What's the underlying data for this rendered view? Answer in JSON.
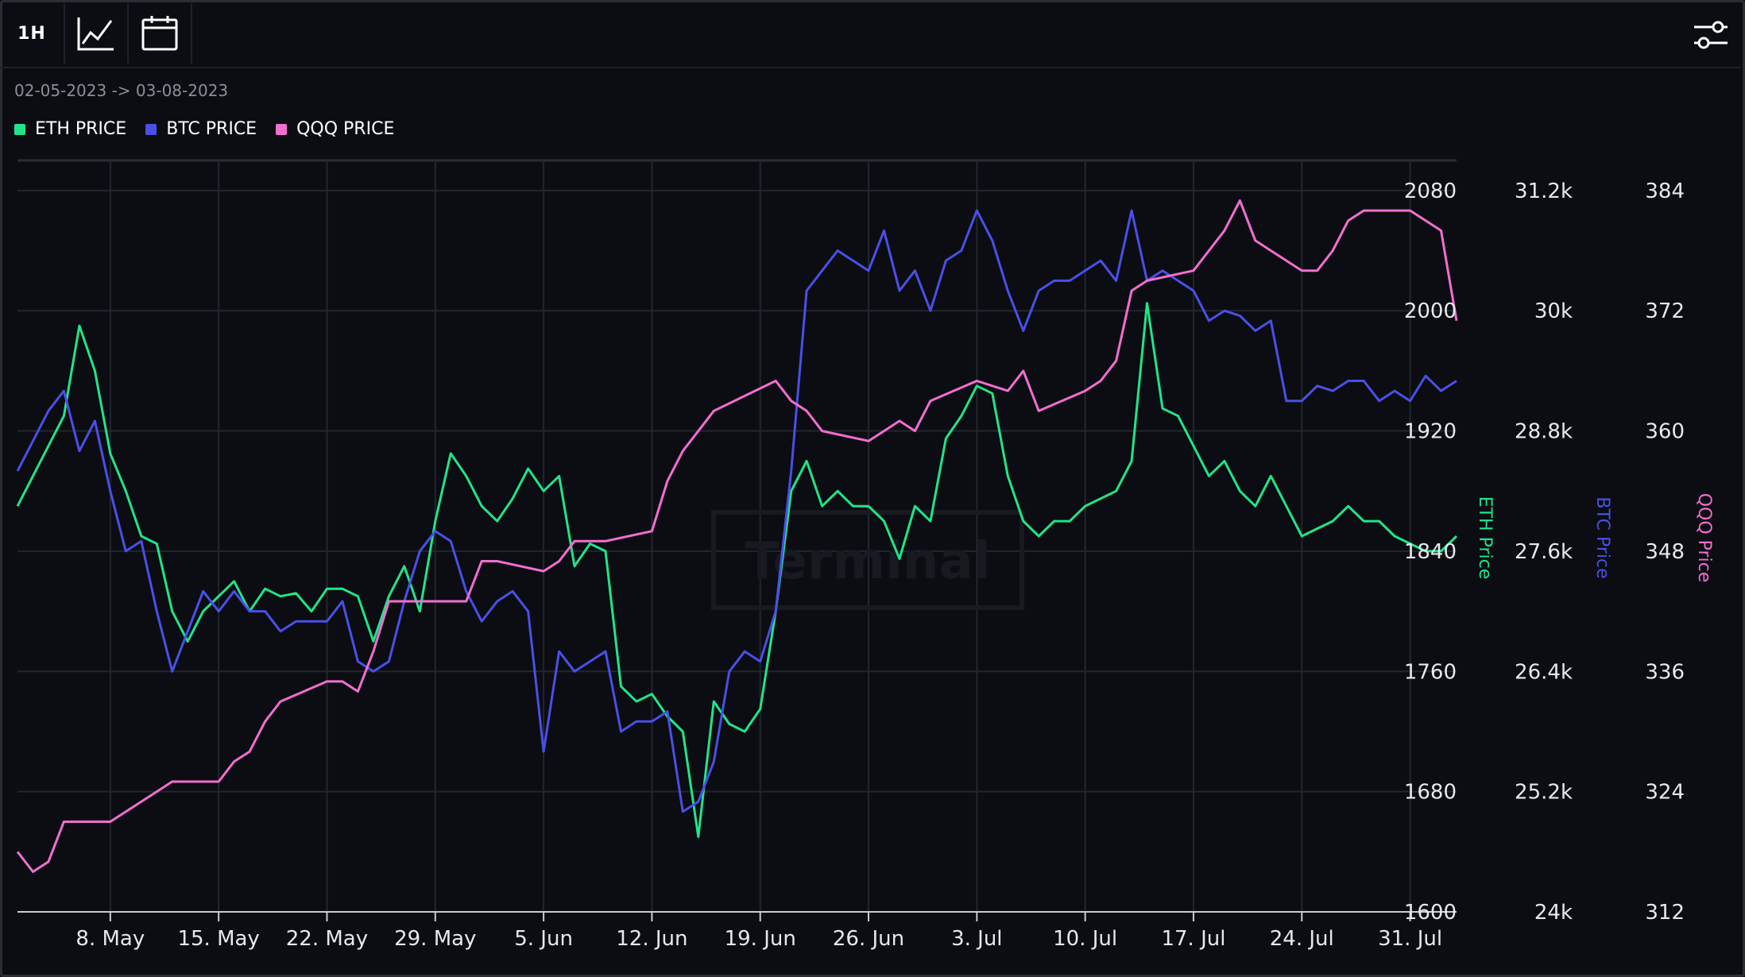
{
  "toolbar": {
    "interval_label": "1H",
    "line_icon": "line-chart-icon",
    "calendar_icon": "calendar-icon",
    "settings_icon": "sliders-icon"
  },
  "date_range": "02-05-2023 -> 03-08-2023",
  "legend": [
    {
      "label": "ETH PRICE",
      "color": "#1fe58a"
    },
    {
      "label": "BTC PRICE",
      "color": "#4a4fe8"
    },
    {
      "label": "QQQ PRICE",
      "color": "#f26ed0"
    }
  ],
  "watermark": "Terminal",
  "chart_data": {
    "type": "line",
    "title": "",
    "x_ticks": [
      "8. May",
      "15. May",
      "22. May",
      "29. May",
      "5. Jun",
      "12. Jun",
      "19. Jun",
      "26. Jun",
      "3. Jul",
      "10. Jul",
      "17. Jul",
      "24. Jul",
      "31. Jul"
    ],
    "x_range": [
      "2023-05-02",
      "2023-08-03"
    ],
    "grid": true,
    "axes": [
      {
        "name": "ETH Price",
        "color": "#1fe58a",
        "range": [
          1600,
          2100
        ],
        "ticks": [
          "2080",
          "2000",
          "1920",
          "1840",
          "1760",
          "1680",
          "1600"
        ]
      },
      {
        "name": "BTC Price",
        "color": "#4a4fe8",
        "range": [
          24000,
          31500
        ],
        "ticks": [
          "31.2k",
          "30k",
          "28.8k",
          "27.6k",
          "26.4k",
          "25.2k",
          "24k"
        ]
      },
      {
        "name": "QQQ Price",
        "color": "#f26ed0",
        "range": [
          312,
          387
        ],
        "ticks": [
          "384",
          "372",
          "360",
          "348",
          "336",
          "324",
          "312"
        ]
      }
    ],
    "series": [
      {
        "name": "ETH PRICE",
        "color": "#1fe58a",
        "x": [
          "2023-05-02",
          "2023-05-03",
          "2023-05-04",
          "2023-05-05",
          "2023-05-06",
          "2023-05-07",
          "2023-05-08",
          "2023-05-09",
          "2023-05-10",
          "2023-05-11",
          "2023-05-12",
          "2023-05-13",
          "2023-05-14",
          "2023-05-15",
          "2023-05-16",
          "2023-05-17",
          "2023-05-18",
          "2023-05-19",
          "2023-05-20",
          "2023-05-21",
          "2023-05-22",
          "2023-05-23",
          "2023-05-24",
          "2023-05-25",
          "2023-05-26",
          "2023-05-27",
          "2023-05-28",
          "2023-05-29",
          "2023-05-30",
          "2023-05-31",
          "2023-06-01",
          "2023-06-02",
          "2023-06-03",
          "2023-06-04",
          "2023-06-05",
          "2023-06-06",
          "2023-06-07",
          "2023-06-08",
          "2023-06-09",
          "2023-06-10",
          "2023-06-11",
          "2023-06-12",
          "2023-06-13",
          "2023-06-14",
          "2023-06-15",
          "2023-06-16",
          "2023-06-17",
          "2023-06-18",
          "2023-06-19",
          "2023-06-20",
          "2023-06-21",
          "2023-06-22",
          "2023-06-23",
          "2023-06-24",
          "2023-06-25",
          "2023-06-26",
          "2023-06-27",
          "2023-06-28",
          "2023-06-29",
          "2023-06-30",
          "2023-07-01",
          "2023-07-02",
          "2023-07-03",
          "2023-07-04",
          "2023-07-05",
          "2023-07-06",
          "2023-07-07",
          "2023-07-08",
          "2023-07-09",
          "2023-07-10",
          "2023-07-11",
          "2023-07-12",
          "2023-07-13",
          "2023-07-14",
          "2023-07-15",
          "2023-07-16",
          "2023-07-17",
          "2023-07-18",
          "2023-07-19",
          "2023-07-20",
          "2023-07-21",
          "2023-07-22",
          "2023-07-23",
          "2023-07-24",
          "2023-07-25",
          "2023-07-26",
          "2023-07-27",
          "2023-07-28",
          "2023-07-29",
          "2023-07-30",
          "2023-07-31",
          "2023-08-01",
          "2023-08-02",
          "2023-08-03"
        ],
        "y": [
          1870,
          1890,
          1910,
          1930,
          1990,
          1960,
          1905,
          1880,
          1850,
          1845,
          1800,
          1780,
          1800,
          1810,
          1820,
          1800,
          1815,
          1810,
          1812,
          1800,
          1815,
          1815,
          1810,
          1780,
          1810,
          1830,
          1800,
          1860,
          1905,
          1890,
          1870,
          1860,
          1875,
          1895,
          1880,
          1890,
          1830,
          1845,
          1840,
          1750,
          1740,
          1745,
          1730,
          1720,
          1650,
          1740,
          1725,
          1720,
          1735,
          1800,
          1880,
          1900,
          1870,
          1880,
          1870,
          1870,
          1860,
          1835,
          1870,
          1860,
          1915,
          1930,
          1950,
          1945,
          1890,
          1860,
          1850,
          1860,
          1860,
          1870,
          1875,
          1880,
          1900,
          2005,
          1935,
          1930,
          1910,
          1890,
          1900,
          1880,
          1870,
          1890,
          1870,
          1850,
          1855,
          1860,
          1870,
          1860,
          1860,
          1850,
          1845,
          1840,
          1840,
          1850
        ]
      },
      {
        "name": "BTC PRICE",
        "color": "#4a4fe8",
        "x": [
          "2023-05-02",
          "2023-05-03",
          "2023-05-04",
          "2023-05-05",
          "2023-05-06",
          "2023-05-07",
          "2023-05-08",
          "2023-05-09",
          "2023-05-10",
          "2023-05-11",
          "2023-05-12",
          "2023-05-13",
          "2023-05-14",
          "2023-05-15",
          "2023-05-16",
          "2023-05-17",
          "2023-05-18",
          "2023-05-19",
          "2023-05-20",
          "2023-05-21",
          "2023-05-22",
          "2023-05-23",
          "2023-05-24",
          "2023-05-25",
          "2023-05-26",
          "2023-05-27",
          "2023-05-28",
          "2023-05-29",
          "2023-05-30",
          "2023-05-31",
          "2023-06-01",
          "2023-06-02",
          "2023-06-03",
          "2023-06-04",
          "2023-06-05",
          "2023-06-06",
          "2023-06-07",
          "2023-06-08",
          "2023-06-09",
          "2023-06-10",
          "2023-06-11",
          "2023-06-12",
          "2023-06-13",
          "2023-06-14",
          "2023-06-15",
          "2023-06-16",
          "2023-06-17",
          "2023-06-18",
          "2023-06-19",
          "2023-06-20",
          "2023-06-21",
          "2023-06-22",
          "2023-06-23",
          "2023-06-24",
          "2023-06-25",
          "2023-06-26",
          "2023-06-27",
          "2023-06-28",
          "2023-06-29",
          "2023-06-30",
          "2023-07-01",
          "2023-07-02",
          "2023-07-03",
          "2023-07-04",
          "2023-07-05",
          "2023-07-06",
          "2023-07-07",
          "2023-07-08",
          "2023-07-09",
          "2023-07-10",
          "2023-07-11",
          "2023-07-12",
          "2023-07-13",
          "2023-07-14",
          "2023-07-15",
          "2023-07-16",
          "2023-07-17",
          "2023-07-18",
          "2023-07-19",
          "2023-07-20",
          "2023-07-21",
          "2023-07-22",
          "2023-07-23",
          "2023-07-24",
          "2023-07-25",
          "2023-07-26",
          "2023-07-27",
          "2023-07-28",
          "2023-07-29",
          "2023-07-30",
          "2023-07-31",
          "2023-08-01",
          "2023-08-02",
          "2023-08-03"
        ],
        "y": [
          28400,
          28700,
          29000,
          29200,
          28600,
          28900,
          28200,
          27600,
          27700,
          27000,
          26400,
          26800,
          27200,
          27000,
          27200,
          27000,
          27000,
          26800,
          26900,
          26900,
          26900,
          27100,
          26500,
          26400,
          26500,
          27100,
          27600,
          27800,
          27700,
          27200,
          26900,
          27100,
          27200,
          27000,
          25600,
          26600,
          26400,
          26500,
          26600,
          25800,
          25900,
          25900,
          26000,
          25000,
          25100,
          25500,
          26400,
          26600,
          26500,
          27000,
          28400,
          30200,
          30400,
          30600,
          30500,
          30400,
          30800,
          30200,
          30400,
          30000,
          30500,
          30600,
          31000,
          30700,
          30200,
          29800,
          30200,
          30300,
          30300,
          30400,
          30500,
          30300,
          31000,
          30300,
          30400,
          30300,
          30200,
          29900,
          30000,
          29950,
          29800,
          29900,
          29100,
          29100,
          29250,
          29200,
          29300,
          29300,
          29100,
          29200,
          29100,
          29350,
          29200,
          29300
        ]
      },
      {
        "name": "QQQ PRICE",
        "color": "#f26ed0",
        "x": [
          "2023-05-02",
          "2023-05-03",
          "2023-05-04",
          "2023-05-05",
          "2023-05-08",
          "2023-05-09",
          "2023-05-10",
          "2023-05-11",
          "2023-05-12",
          "2023-05-15",
          "2023-05-16",
          "2023-05-17",
          "2023-05-18",
          "2023-05-19",
          "2023-05-22",
          "2023-05-23",
          "2023-05-24",
          "2023-05-25",
          "2023-05-26",
          "2023-05-30",
          "2023-05-31",
          "2023-06-01",
          "2023-06-02",
          "2023-06-05",
          "2023-06-06",
          "2023-06-07",
          "2023-06-08",
          "2023-06-09",
          "2023-06-12",
          "2023-06-13",
          "2023-06-14",
          "2023-06-15",
          "2023-06-16",
          "2023-06-20",
          "2023-06-21",
          "2023-06-22",
          "2023-06-23",
          "2023-06-26",
          "2023-06-27",
          "2023-06-28",
          "2023-06-29",
          "2023-06-30",
          "2023-07-03",
          "2023-07-05",
          "2023-07-06",
          "2023-07-07",
          "2023-07-10",
          "2023-07-11",
          "2023-07-12",
          "2023-07-13",
          "2023-07-14",
          "2023-07-17",
          "2023-07-18",
          "2023-07-19",
          "2023-07-20",
          "2023-07-21",
          "2023-07-24",
          "2023-07-25",
          "2023-07-26",
          "2023-07-27",
          "2023-07-28",
          "2023-07-31",
          "2023-08-01",
          "2023-08-02",
          "2023-08-03"
        ],
        "y": [
          318,
          316,
          317,
          321,
          321,
          322,
          323,
          324,
          325,
          325,
          327,
          328,
          331,
          333,
          335,
          335,
          334,
          338,
          343,
          343,
          343,
          347,
          347,
          346,
          347,
          349,
          349,
          349,
          350,
          355,
          358,
          360,
          362,
          365,
          363,
          362,
          360,
          359,
          360,
          361,
          360,
          363,
          365,
          364,
          366,
          362,
          364,
          365,
          367,
          374,
          375,
          376,
          378,
          380,
          383,
          379,
          376,
          376,
          378,
          381,
          382,
          382,
          381,
          380,
          371
        ]
      }
    ]
  }
}
